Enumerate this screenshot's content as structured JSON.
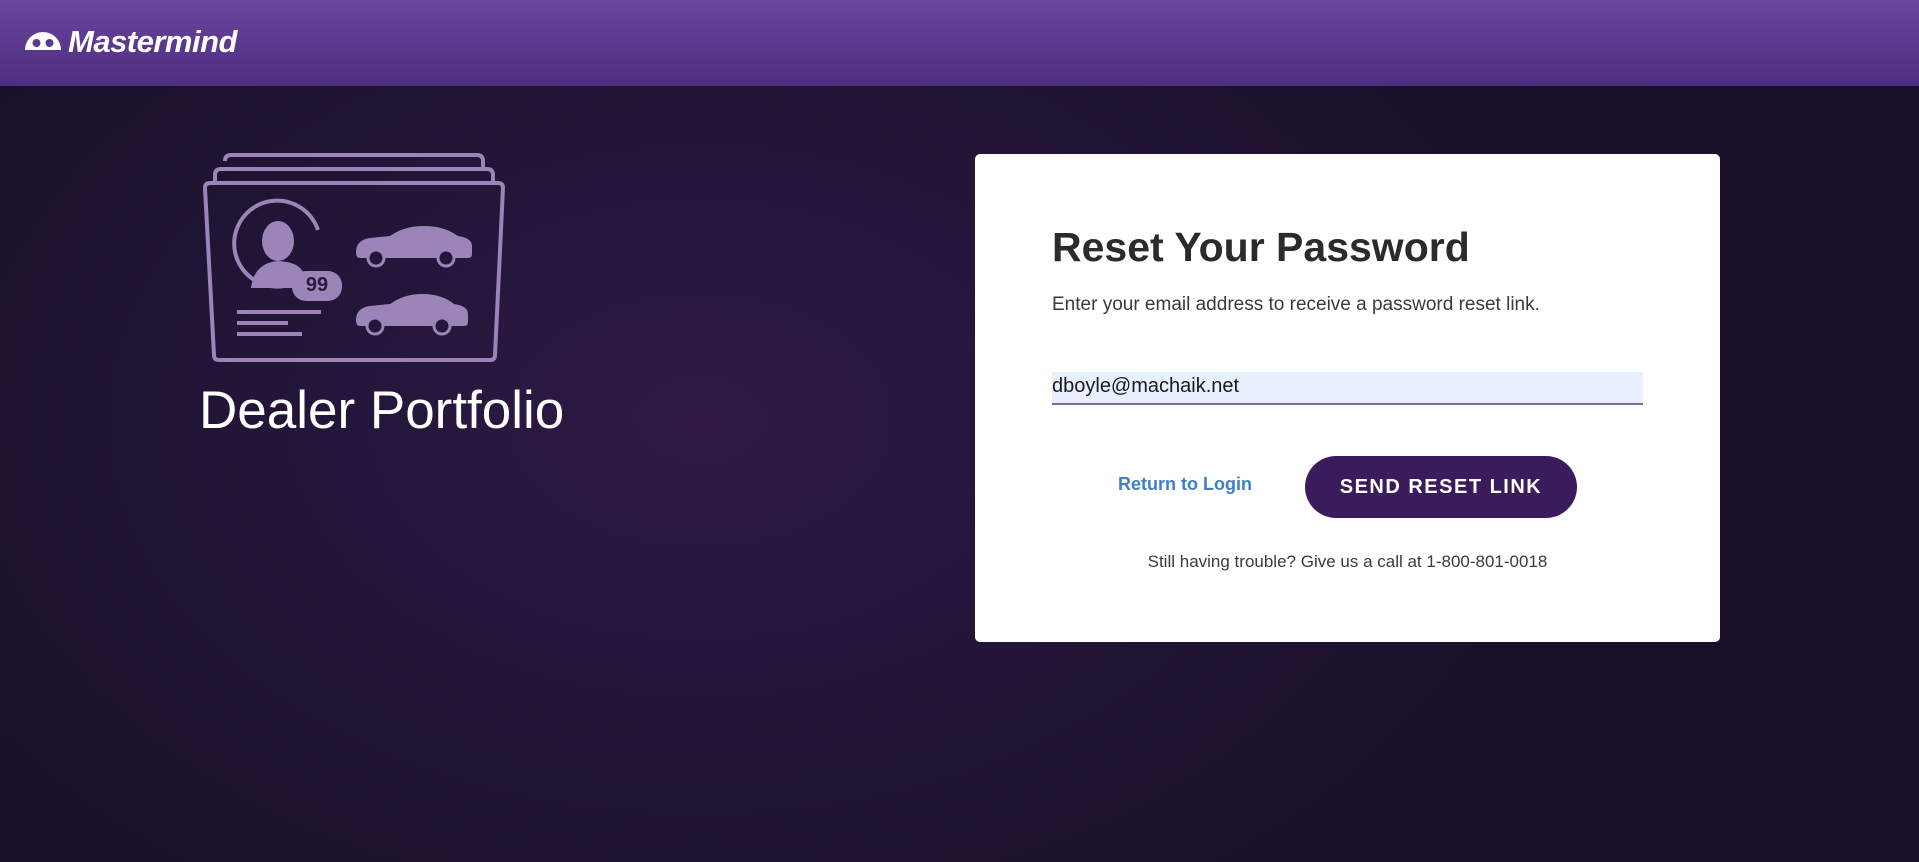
{
  "header": {
    "brand_name": "Mastermind",
    "brand_icon": "mastermind-logo-icon"
  },
  "hero": {
    "icon": "dealer-portfolio-icon",
    "badge_number": "99",
    "title": "Dealer Portfolio"
  },
  "reset_form": {
    "title": "Reset Your Password",
    "subtitle": "Enter your email address to receive a password reset link.",
    "email_value": "dboyle@machaik.net",
    "return_link_label": "Return to Login",
    "submit_label": "SEND RESET LINK",
    "help_text": "Still having trouble? Give us a call at 1-800-801-0018"
  },
  "colors": {
    "header_top": "#6a45a0",
    "header_bottom": "#4e2d7f",
    "background": "#24163a",
    "button": "#3a1c5c",
    "link": "#3f7fc6",
    "icon_stroke": "#9b84b8"
  }
}
